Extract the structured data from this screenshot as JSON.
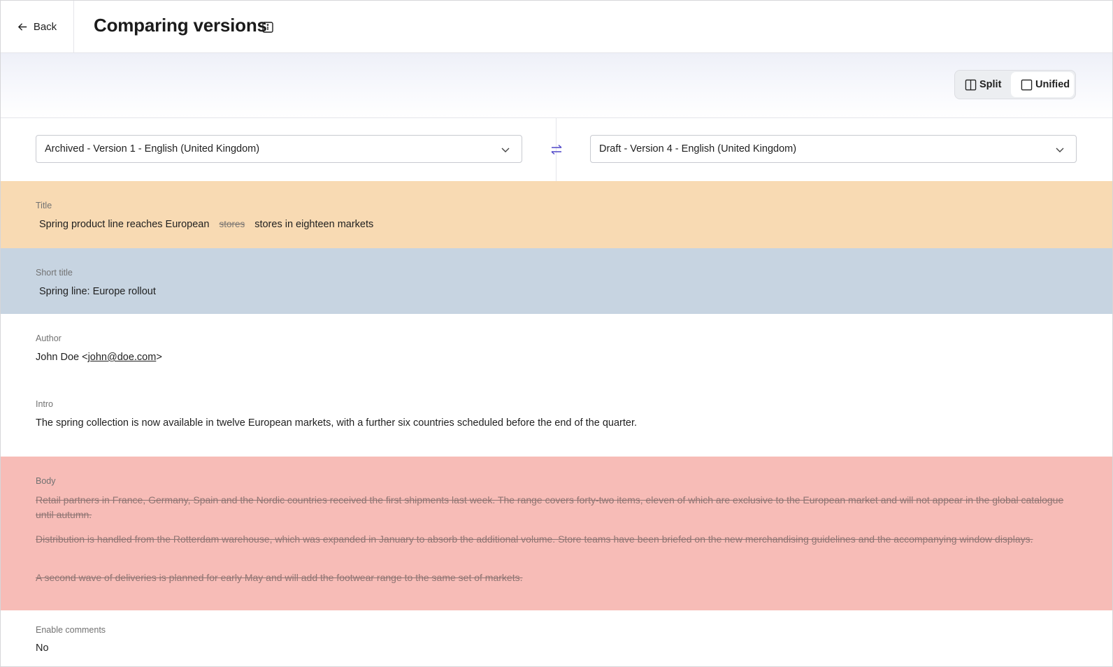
{
  "header": {
    "back_label": "Back",
    "title": "Comparing versions"
  },
  "view_toggle": {
    "split_label": "Split",
    "unified_label": "Unified",
    "active": "Unified"
  },
  "selectors": {
    "left_value": "Archived - Version 1 - English (United Kingdom)",
    "right_value": "Draft - Version 4 - English (United Kingdom)"
  },
  "fields": {
    "title": {
      "label": "Title",
      "prefix": "Spring product line reaches European",
      "removed": "stores",
      "added": "stores in eighteen markets",
      "status": "changed",
      "color": "#f8dab3"
    },
    "short_title": {
      "label": "Short title",
      "value": "Spring line: Europe rollout",
      "status": "added",
      "color": "#c7d4e1"
    },
    "author": {
      "label": "Author",
      "name": "John Doe <",
      "email": "john@doe.com",
      "suffix": ">"
    },
    "intro": {
      "label": "Intro",
      "value": "The spring collection is now available in twelve European markets, with a further six countries scheduled before the end of the quarter."
    },
    "body": {
      "label": "Body",
      "status": "removed",
      "color": "#f7bcb7",
      "paragraphs": [
        "Retail partners in France, Germany, Spain and the Nordic countries received the first shipments last week. The range covers forty-two items, eleven of which are exclusive to the European market and will not appear in the global catalogue until autumn.",
        "Distribution is handled from the Rotterdam warehouse, which was expanded in January to absorb the additional volume. Store teams have been briefed on the new merchandising guidelines and the accompanying window displays.",
        "A second wave of deliveries is planned for early May and will add the footwear range to the same set of markets."
      ]
    },
    "enable_comments": {
      "label": "Enable comments",
      "value": "No"
    }
  },
  "icons": {
    "back": "arrow-left-icon",
    "info": "info-icon",
    "split": "split-view-icon",
    "unified": "unified-view-icon",
    "chevron": "chevron-down-icon",
    "swap": "swap-arrows-icon"
  },
  "colors": {
    "accent": "#4f46c8"
  }
}
